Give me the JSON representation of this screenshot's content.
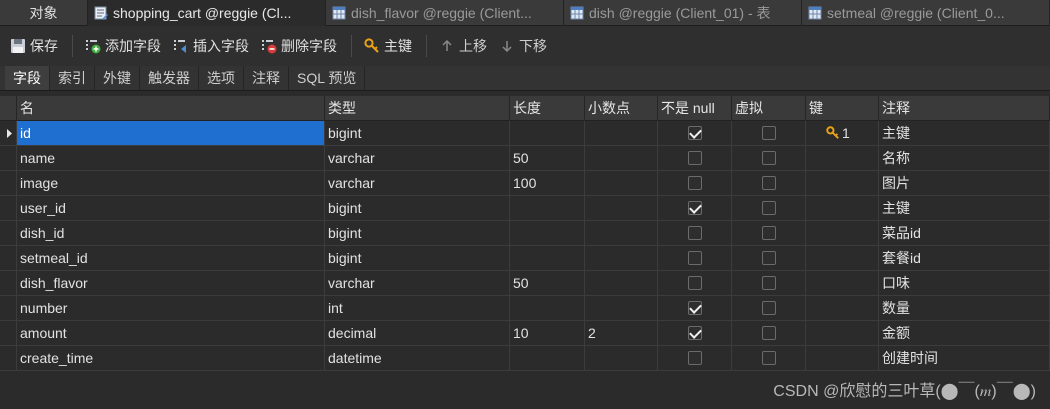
{
  "tabs": [
    {
      "label": "对象",
      "icon": ""
    },
    {
      "label": "shopping_cart @reggie (Cl...",
      "icon": "table-edit-icon"
    },
    {
      "label": "dish_flavor @reggie (Client...",
      "icon": "table-icon"
    },
    {
      "label": "dish @reggie (Client_01) - 表",
      "icon": "table-icon"
    },
    {
      "label": "setmeal @reggie (Client_0...",
      "icon": "table-icon"
    }
  ],
  "toolbar": {
    "save": "保存",
    "add_field": "添加字段",
    "insert_field": "插入字段",
    "delete_field": "删除字段",
    "primary_key": "主键",
    "move_up": "上移",
    "move_down": "下移"
  },
  "subtabs": [
    "字段",
    "索引",
    "外键",
    "触发器",
    "选项",
    "注释",
    "SQL 预览"
  ],
  "columns": {
    "name": "名",
    "type": "类型",
    "length": "长度",
    "decimals": "小数点",
    "not_null": "不是 null",
    "virtual": "虚拟",
    "key": "键",
    "comment": "注释"
  },
  "rows": [
    {
      "name": "id",
      "type": "bigint",
      "length": "",
      "decimals": "",
      "not_null": true,
      "virtual": false,
      "key": "1",
      "comment": "主键"
    },
    {
      "name": "name",
      "type": "varchar",
      "length": "50",
      "decimals": "",
      "not_null": false,
      "virtual": false,
      "key": "",
      "comment": "名称"
    },
    {
      "name": "image",
      "type": "varchar",
      "length": "100",
      "decimals": "",
      "not_null": false,
      "virtual": false,
      "key": "",
      "comment": "图片"
    },
    {
      "name": "user_id",
      "type": "bigint",
      "length": "",
      "decimals": "",
      "not_null": true,
      "virtual": false,
      "key": "",
      "comment": "主键"
    },
    {
      "name": "dish_id",
      "type": "bigint",
      "length": "",
      "decimals": "",
      "not_null": false,
      "virtual": false,
      "key": "",
      "comment": "菜品id"
    },
    {
      "name": "setmeal_id",
      "type": "bigint",
      "length": "",
      "decimals": "",
      "not_null": false,
      "virtual": false,
      "key": "",
      "comment": "套餐id"
    },
    {
      "name": "dish_flavor",
      "type": "varchar",
      "length": "50",
      "decimals": "",
      "not_null": false,
      "virtual": false,
      "key": "",
      "comment": "口味"
    },
    {
      "name": "number",
      "type": "int",
      "length": "",
      "decimals": "",
      "not_null": true,
      "virtual": false,
      "key": "",
      "comment": "数量"
    },
    {
      "name": "amount",
      "type": "decimal",
      "length": "10",
      "decimals": "2",
      "not_null": true,
      "virtual": false,
      "key": "",
      "comment": "金额"
    },
    {
      "name": "create_time",
      "type": "datetime",
      "length": "",
      "decimals": "",
      "not_null": false,
      "virtual": false,
      "key": "",
      "comment": "创建时间"
    }
  ],
  "watermark": "CSDN @欣慰的三叶草(⬤￣(𝆐)￣⬤)",
  "colors": {
    "selection": "#1f6fd1",
    "key_icon": "#e8a317"
  }
}
